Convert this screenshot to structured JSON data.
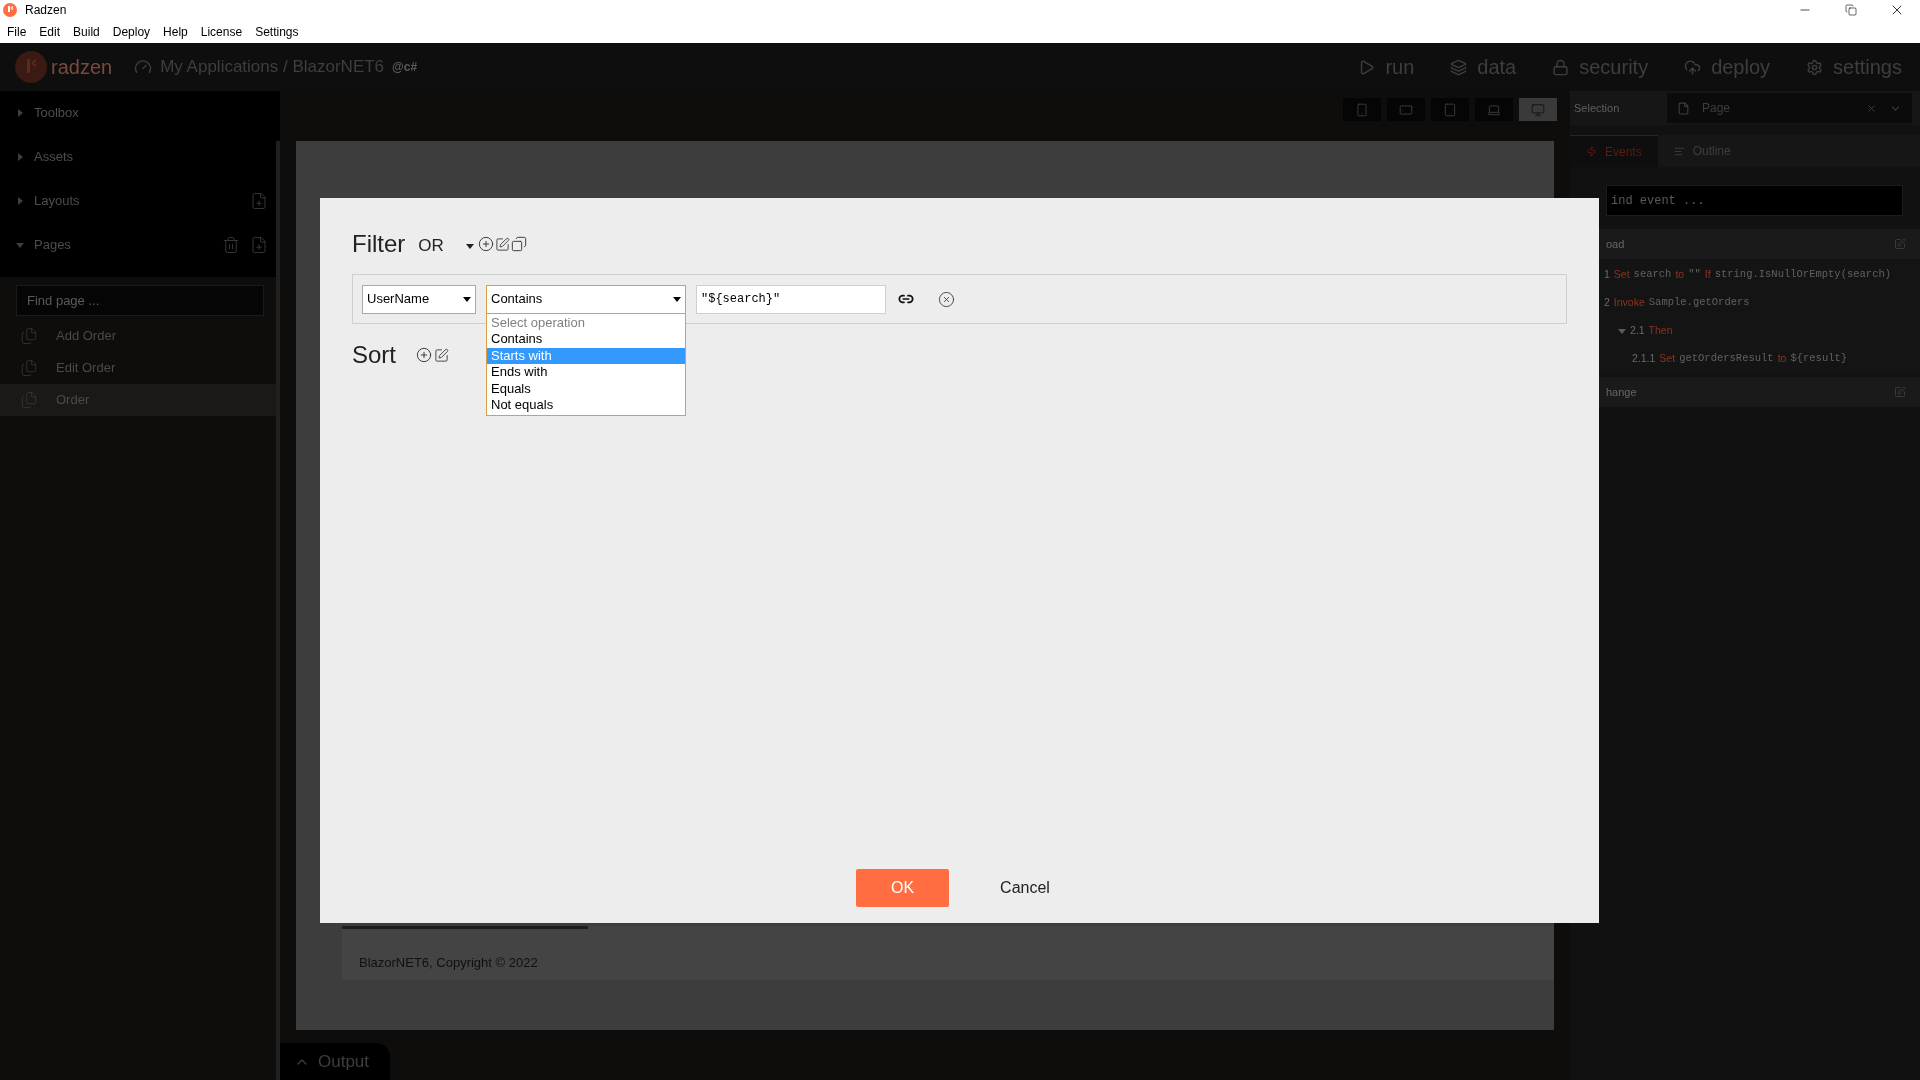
{
  "window": {
    "title": "Radzen",
    "menu": [
      "File",
      "Edit",
      "Build",
      "Deploy",
      "Help",
      "License",
      "Settings"
    ]
  },
  "header": {
    "brand": "radzen",
    "breadcrumb": "My Applications / BlazorNET6",
    "badge": "@c#",
    "nav": [
      {
        "label": "run",
        "kind": "play"
      },
      {
        "label": "data",
        "kind": "layers"
      },
      {
        "label": "security",
        "kind": "lock"
      },
      {
        "label": "deploy",
        "kind": "cloud"
      },
      {
        "label": "settings",
        "kind": "gear"
      }
    ]
  },
  "sidebar": {
    "sections": [
      {
        "label": "Toolbox",
        "expanded": false,
        "kind": "plain"
      },
      {
        "label": "Assets",
        "expanded": false,
        "kind": "plain"
      },
      {
        "label": "Layouts",
        "expanded": false,
        "kind": "add"
      },
      {
        "label": "Pages",
        "expanded": true,
        "kind": "add-delete"
      }
    ],
    "search": {
      "placeholder": "Find page ..."
    },
    "pages": [
      {
        "label": "Add Order",
        "selected": false
      },
      {
        "label": "Edit Order",
        "selected": false
      },
      {
        "label": "Order",
        "selected": true
      }
    ]
  },
  "devices": [
    {
      "kind": "phone",
      "selected": false
    },
    {
      "kind": "phone-landscape",
      "selected": false
    },
    {
      "kind": "tablet",
      "selected": false
    },
    {
      "kind": "laptop",
      "selected": false
    },
    {
      "kind": "desktop",
      "selected": true
    }
  ],
  "selection": {
    "label": "Selection",
    "value": "Page"
  },
  "inspector": {
    "tabs": [
      {
        "label": "Events",
        "selected": true,
        "kind": "events"
      },
      {
        "label": "Outline",
        "selected": false,
        "kind": "outline"
      }
    ],
    "search": {
      "placeholder": "ind event ..."
    },
    "events": [
      {
        "name": "oad",
        "actions": [
          {
            "segments": [
              {
                "text": "1",
                "kind": "num"
              },
              {
                "text": "Set",
                "kind": "kw"
              },
              {
                "text": "search",
                "kind": "code"
              },
              {
                "text": "to",
                "kind": "kw"
              },
              {
                "text": "\"\"",
                "kind": "code"
              },
              {
                "text": "If",
                "kind": "kw"
              },
              {
                "text": "string.IsNullOrEmpty(search)",
                "kind": "code"
              }
            ]
          },
          {
            "segments": [
              {
                "text": "2",
                "kind": "num"
              },
              {
                "text": "Invoke",
                "kind": "kw"
              },
              {
                "text": "Sample.getOrders",
                "kind": "code"
              }
            ],
            "children": [
              {
                "segments": [
                  {
                    "text": "2.1",
                    "kind": "num"
                  },
                  {
                    "text": "Then",
                    "kind": "kw"
                  }
                ],
                "expanded": true,
                "children": [
                  {
                    "segments": [
                      {
                        "text": "2.1.1",
                        "kind": "num"
                      },
                      {
                        "text": "Set",
                        "kind": "kw"
                      },
                      {
                        "text": "getOrdersResult",
                        "kind": "code"
                      },
                      {
                        "text": "to",
                        "kind": "kw"
                      },
                      {
                        "text": "${result}",
                        "kind": "code"
                      }
                    ]
                  }
                ]
              }
            ]
          }
        ]
      },
      {
        "name": "hange"
      }
    ]
  },
  "canvas": {
    "footer": "BlazorNET6, Copyright © 2022"
  },
  "dialog": {
    "filter": {
      "title": "Filter",
      "logic": "OR",
      "conditions": [
        {
          "field": "UserName",
          "operation": "Contains",
          "value": "\"${search}\"",
          "open": true,
          "options": [
            {
              "label": "Select operation",
              "selected": false,
              "disabled": true
            },
            {
              "label": "Contains",
              "selected": false,
              "disabled": false
            },
            {
              "label": "Starts with",
              "selected": true,
              "disabled": false
            },
            {
              "label": "Ends with",
              "selected": false,
              "disabled": false
            },
            {
              "label": "Equals",
              "selected": false,
              "disabled": false
            },
            {
              "label": "Not equals",
              "selected": false,
              "disabled": false
            }
          ]
        }
      ]
    },
    "sort": {
      "title": "Sort"
    },
    "buttons": [
      {
        "label": "OK",
        "kind": "primary"
      },
      {
        "label": "Cancel",
        "kind": "text"
      }
    ]
  },
  "output": {
    "label": "Output"
  }
}
